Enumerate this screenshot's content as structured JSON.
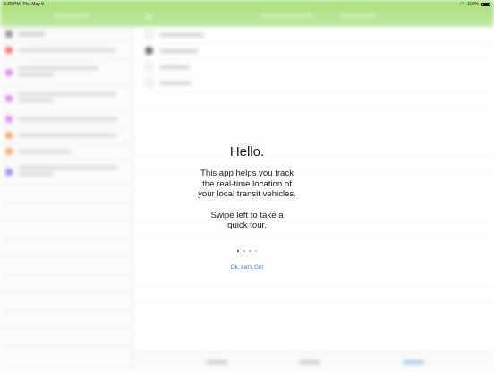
{
  "status_bar": {
    "time": "3:29 PM",
    "date": "Thu May 9",
    "battery_percent": "100%"
  },
  "colors": {
    "nav_green": "#a8e07a",
    "link_blue": "#1a7be0"
  },
  "onboarding": {
    "title": "Hello.",
    "description_lines": [
      "This app helps you track",
      "the real-time location of",
      "your local transit vehicles."
    ],
    "swipe_lines": [
      "Swipe left to take a",
      "quick tour."
    ],
    "page_count": 4,
    "current_page": 1,
    "go_button": "Ok. Let's Go!"
  }
}
